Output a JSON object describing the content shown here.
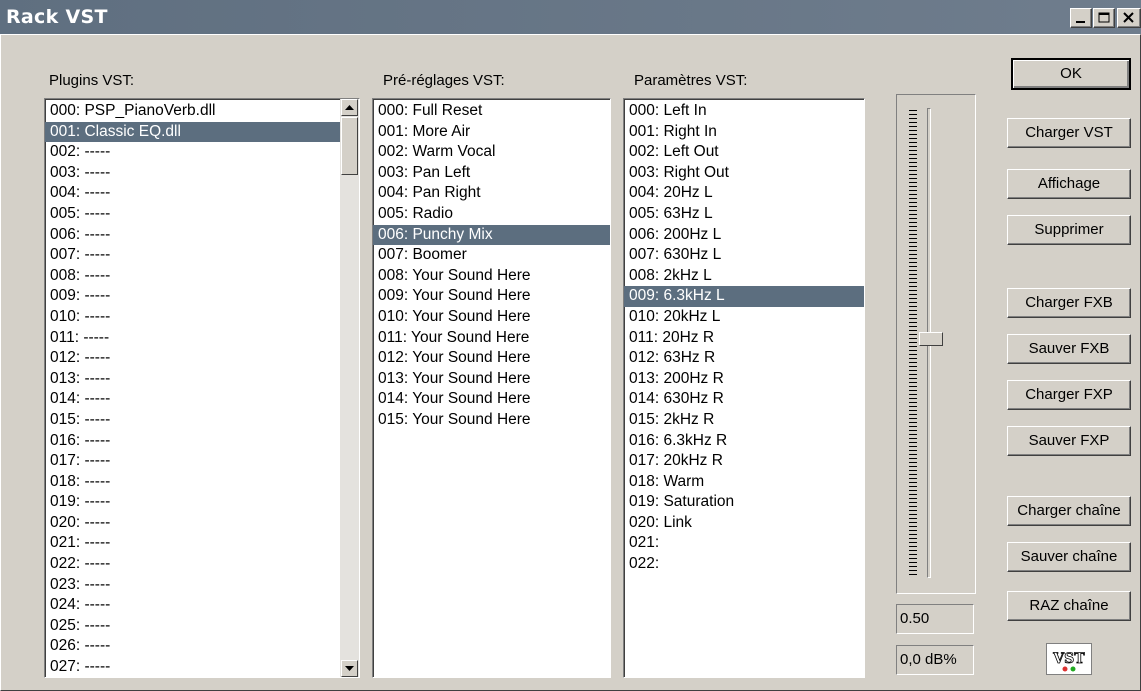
{
  "window": {
    "title": "Rack VST"
  },
  "plugins": {
    "header": "Plugins VST:",
    "items": [
      "000: PSP_PianoVerb.dll",
      "001: Classic EQ.dll",
      "002: -----",
      "003: -----",
      "004: -----",
      "005: -----",
      "006: -----",
      "007: -----",
      "008: -----",
      "009: -----",
      "010: -----",
      "011: -----",
      "012: -----",
      "013: -----",
      "014: -----",
      "015: -----",
      "016: -----",
      "017: -----",
      "018: -----",
      "019: -----",
      "020: -----",
      "021: -----",
      "022: -----",
      "023: -----",
      "024: -----",
      "025: -----",
      "026: -----",
      "027: -----"
    ],
    "selected_index": 1
  },
  "presets": {
    "header": "Pré-réglages VST:",
    "items": [
      "000: Full Reset",
      "001: More Air",
      "002: Warm Vocal",
      "003: Pan Left",
      "004: Pan Right",
      "005: Radio",
      "006: Punchy Mix",
      "007: Boomer",
      "008: Your Sound Here",
      "009: Your Sound Here",
      "010: Your Sound Here",
      "011: Your Sound Here",
      "012: Your Sound Here",
      "013: Your Sound Here",
      "014: Your Sound Here",
      "015: Your Sound Here"
    ],
    "selected_index": 6
  },
  "parameters": {
    "header": "Paramètres VST:",
    "items": [
      "000: Left In",
      "001: Right In",
      "002: Left Out",
      "003: Right Out",
      "004: 20Hz L",
      "005: 63Hz L",
      "006: 200Hz L",
      "007: 630Hz L",
      "008: 2kHz L",
      "009: 6.3kHz L",
      "010: 20kHz L",
      "011: 20Hz R",
      "012: 63Hz R",
      "013: 200Hz R",
      "014: 630Hz R",
      "015: 2kHz R",
      "016: 6.3kHz R",
      "017: 20kHz R",
      "018: Warm",
      "019: Saturation",
      "020: Link",
      "021:",
      "022:"
    ],
    "selected_index": 9
  },
  "buttons": {
    "ok": "OK",
    "load_vst": "Charger VST",
    "display": "Affichage",
    "delete": "Supprimer",
    "load_fxb": "Charger FXB",
    "save_fxb": "Sauver FXB",
    "load_fxp": "Charger FXP",
    "save_fxp": "Sauver FXP",
    "load_chain": "Charger chaîne",
    "save_chain": "Sauver chaîne",
    "reset_chain": "RAZ chaîne"
  },
  "slider": {
    "value": "0.50",
    "db": "0,0 dB%",
    "level": 0.5
  },
  "logo": {
    "text": "VST"
  },
  "colors": {
    "selection": "#5c6e7f",
    "title_bar": "#64717f",
    "face": "#d4d0c8"
  }
}
